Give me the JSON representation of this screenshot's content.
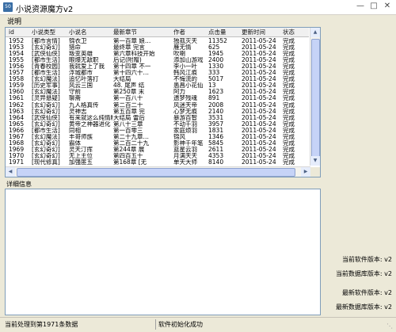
{
  "window": {
    "title": "小说资源魔方v2",
    "icon_name": "app-icon",
    "icon_text": "50"
  },
  "menu": {
    "items": [
      "说明"
    ]
  },
  "table": {
    "columns": [
      "id",
      "小说类型",
      "小说名",
      "最新章节",
      "作者",
      "点击量",
      "更新时间",
      "状态"
    ],
    "rows": [
      [
        "1952",
        "[都市言情]",
        "锦衣卫",
        "第一百章 娘…",
        "独孤灭天",
        "11352",
        "2011-05-24",
        "完成"
      ],
      [
        "1953",
        "[玄幻奇幻]",
        "猎命",
        "最终章 完言",
        "雁无情",
        "625",
        "2011-05-24",
        "完成"
      ],
      [
        "1954",
        "[武侠仙侠]",
        "叛变英雄",
        "第六章科技开始",
        "吹喇",
        "1945",
        "2011-05-24",
        "完成"
      ],
      [
        "1955",
        "[都市生活]",
        "眼爆无敌职",
        "后记(附赠)",
        "添加山游戏",
        "2400",
        "2011-05-24",
        "完成"
      ],
      [
        "1956",
        "[青春校园]",
        "我就爱上了我",
        "第十四章 不一",
        "李小一叶",
        "1330",
        "2011-05-24",
        "完成"
      ],
      [
        "1957",
        "[都市生活]",
        "浮城都市",
        "第十四六十…",
        "韩风江痕",
        "333",
        "2011-05-24",
        "完成"
      ],
      [
        "1958",
        "[玄幻魔法]",
        "追忆叶落打",
        "大结局",
        "不悔流的",
        "5017",
        "2011-05-24",
        "完成"
      ],
      [
        "1959",
        "[历史军事]",
        "风云三国",
        "48. 尾声 结",
        "愚昌小花仙",
        "13",
        "2011-05-24",
        "完成"
      ],
      [
        "1960",
        "[玄幻魔法]",
        "守前",
        "第250章 末",
        "阿力",
        "1623",
        "2011-05-24",
        "完成"
      ],
      [
        "1961",
        "[灵异悬疑]",
        "聊斋",
        "第一百八十",
        "遗梦残魂",
        "891",
        "2011-05-24",
        "完成"
      ],
      [
        "1962",
        "[玄幻奇幻]",
        "九人格真传",
        "第二百二十",
        "风迷天帝",
        "2008",
        "2011-05-24",
        "完成"
      ],
      [
        "1963",
        "[玄幻奇幻]",
        "灵神志",
        "第五百章 完",
        "心梦无痕",
        "2140",
        "2011-05-24",
        "完成"
      ],
      [
        "1964",
        "[武侠仙侠]",
        "有来就这么纯情精",
        "大结局 雷后",
        "暴游百智",
        "3531",
        "2011-05-24",
        "完成"
      ],
      [
        "1965",
        "[玄幻奇幻]",
        "黄帝之神器进化",
        "第八十三章",
        "不动千羽",
        "3957",
        "2011-05-24",
        "完成"
      ],
      [
        "1966",
        "[都市生活]",
        "同相",
        "第一百零三",
        "家庭烦羽",
        "1831",
        "2011-05-24",
        "完成"
      ],
      [
        "1967",
        "[玄幻魔法]",
        "丰哥师族",
        "第二十九章…",
        "锦风",
        "1346",
        "2011-05-24",
        "完成"
      ],
      [
        "1968",
        "[玄幻奇幻]",
        "霸体",
        "第二百二十九",
        "影神千年笔",
        "5845",
        "2011-05-24",
        "完成"
      ],
      [
        "1969",
        "[玄幻奇幻]",
        "灵天汀挥",
        "第244章 展",
        "蓝星云羽",
        "2611",
        "2011-05-24",
        "完成"
      ],
      [
        "1970",
        "[玄幻奇幻]",
        "无上主位",
        "第四百五十",
        "月满天天",
        "4353",
        "2011-05-24",
        "完成"
      ],
      [
        "1971",
        "[现代修真]",
        "加强匪五",
        "第168章 [无",
        "单天大师",
        "8140",
        "2011-05-24",
        "完成"
      ]
    ]
  },
  "detail": {
    "label": "详细信息"
  },
  "side_labels": [
    "当前软件版本: v2",
    "当前数据库版本: v2",
    "最新软件版本: v2",
    "最新数据库版本: v2"
  ],
  "status": {
    "left": "当前处理到第1971条数据",
    "right": "软件初始化成功"
  },
  "icons": [
    "app-icon",
    "minimize-icon",
    "maximize-icon",
    "close-icon",
    "scroll-up-icon",
    "scroll-down-icon",
    "scroll-left-icon",
    "scroll-right-icon",
    "resize-grip-icon"
  ],
  "colors": {
    "grid_border": "#7f9db9",
    "window_bg": "#ece9d8",
    "scroll_thumb": "#c6d3f7"
  }
}
